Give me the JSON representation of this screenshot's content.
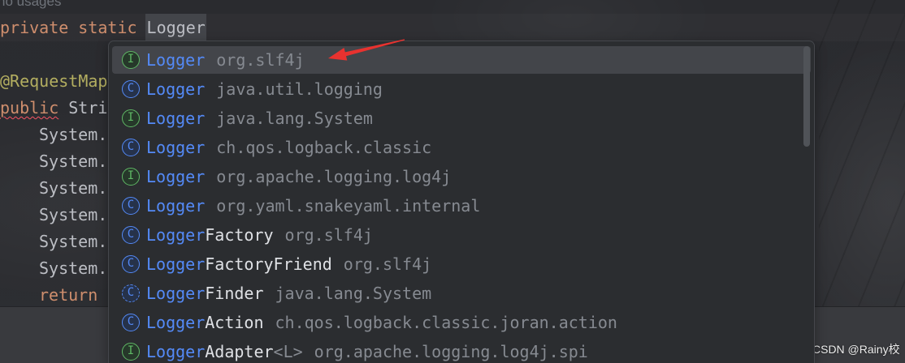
{
  "editor": {
    "inlay_hint": "no usages",
    "decl_line": {
      "modifier_1": "private",
      "modifier_2": "static",
      "type": "Logger"
    },
    "annotation_line": "@RequestMap",
    "method_line": {
      "modifier": "public",
      "return_type": "Stri"
    },
    "statement_lines": [
      "System.",
      "System.",
      "System.",
      "System.",
      "System.",
      "System."
    ],
    "return_line": "return"
  },
  "completion_popup": {
    "items": [
      {
        "icon": "interface-icon",
        "icon_letter": "I",
        "match": "Logger",
        "package": "org.slf4j",
        "selected": true
      },
      {
        "icon": "class-icon",
        "icon_letter": "C",
        "match": "Logger",
        "package": "java.util.logging"
      },
      {
        "icon": "interface-icon",
        "icon_letter": "I",
        "match": "Logger",
        "package": "java.lang.System"
      },
      {
        "icon": "class-icon",
        "icon_letter": "C",
        "match": "Logger",
        "package": "ch.qos.logback.classic"
      },
      {
        "icon": "interface-icon",
        "icon_letter": "I",
        "match": "Logger",
        "package": "org.apache.logging.log4j"
      },
      {
        "icon": "class-icon",
        "icon_letter": "C",
        "match": "Logger",
        "package": "org.yaml.snakeyaml.internal"
      },
      {
        "icon": "class-icon",
        "icon_letter": "C",
        "match": "Logger",
        "rest": "Factory",
        "package": "org.slf4j"
      },
      {
        "icon": "class-icon",
        "icon_letter": "C",
        "match": "Logger",
        "rest": "FactoryFriend",
        "package": "org.slf4j"
      },
      {
        "icon": "abstract-class-icon",
        "icon_letter": "C",
        "match": "Logger",
        "rest": "Finder",
        "package": "java.lang.System"
      },
      {
        "icon": "class-icon",
        "icon_letter": "C",
        "match": "Logger",
        "rest": "Action",
        "package": "ch.qos.logback.classic.joran.action"
      },
      {
        "icon": "interface-icon",
        "icon_letter": "I",
        "match": "Logger",
        "rest": "Adapter",
        "type_params": "<L>",
        "package": "org.apache.logging.log4j.spi"
      }
    ]
  },
  "watermark": "CSDN @Rainy校",
  "colors": {
    "keyword": "#CF8E6D",
    "annotation": "#B3AE60",
    "default_text": "#BCBEC4",
    "match_highlight": "#548AF7",
    "package_text": "#868A91",
    "class_icon": "#548AF7",
    "interface_icon": "#5FB865",
    "error_underline": "#F75464",
    "popup_background": "#2B2D30",
    "selected_row": "#43454A",
    "annotation_arrow": "#E8322F"
  }
}
